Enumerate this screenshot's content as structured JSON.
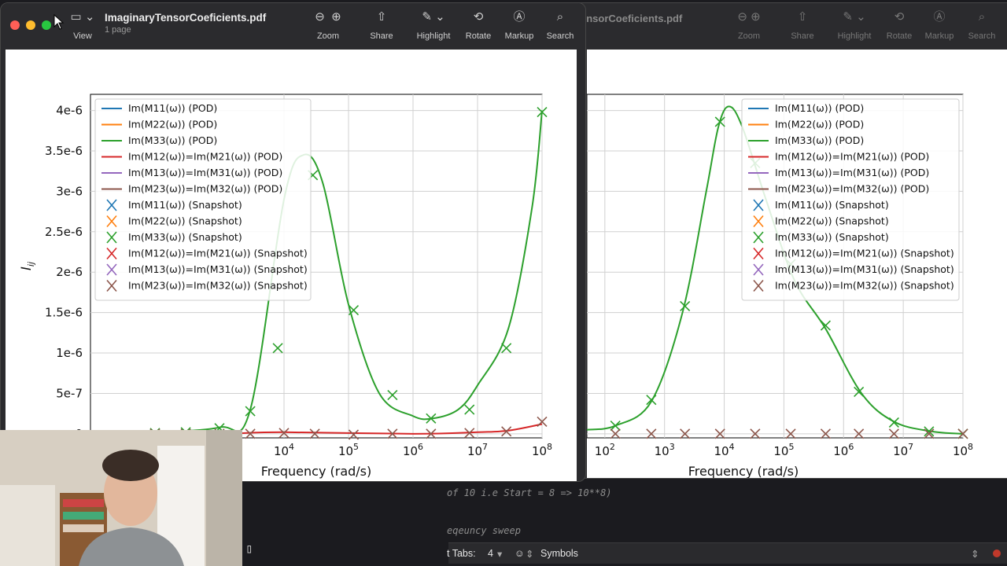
{
  "editor": {
    "code_lines": [
      "of 10 i.e Start = 8 => 10**8)",
      "eqeuncy sweep"
    ],
    "status": {
      "tabs_label": "t Tabs:",
      "tabs_value": "4",
      "symbols_label": "Symbols"
    }
  },
  "window_left": {
    "title": "ImaginaryTensorCoeficients.pdf",
    "subtitle": "1 page",
    "toolbar": [
      {
        "label": "View",
        "icon": "sidebar-icon"
      },
      {
        "label": "Zoom",
        "icon": "zoom-out-icon"
      },
      {
        "label": "Share",
        "icon": "share-icon"
      },
      {
        "label": "Highlight",
        "icon": "highlight-icon"
      },
      {
        "label": "Rotate",
        "icon": "rotate-icon"
      },
      {
        "label": "Markup",
        "icon": "markup-icon"
      },
      {
        "label": "Search",
        "icon": "search-icon"
      }
    ]
  },
  "window_right": {
    "title": "ensorCoeficients.pdf",
    "toolbar": [
      "Zoom",
      "Share",
      "Highlight",
      "Rotate",
      "Markup",
      "Search"
    ]
  },
  "colors": {
    "M11": "#1f77b4",
    "M22": "#ff7f0e",
    "M33": "#2ca02c",
    "M12": "#d62728",
    "M13": "#9467bd",
    "M23": "#8c564b"
  },
  "chart_data": [
    {
      "type": "line",
      "xlabel": "Frequency (rad/s)",
      "ylabel": "I_ij",
      "x_scale": "log",
      "xlim": [
        10,
        100000000
      ],
      "ylim": [
        -5e-08,
        4.2e-06
      ],
      "xticks": [
        "10^4",
        "10^5",
        "10^6",
        "10^7",
        "10^8"
      ],
      "yticks": [
        "0",
        "5e-7",
        "1e-6",
        "1.5e-6",
        "2e-6",
        "2.5e-6",
        "3e-6",
        "3.5e-6",
        "4e-6"
      ],
      "grid": true,
      "legend": "top-left",
      "legend_entries": [
        "Im(M11(ω)) (POD)",
        "Im(M22(ω)) (POD)",
        "Im(M33(ω)) (POD)",
        "Im(M12(ω))=Im(M21(ω)) (POD)",
        "Im(M13(ω))=Im(M31(ω)) (POD)",
        "Im(M23(ω))=Im(M32(ω)) (POD)",
        "Im(M11(ω)) (Snapshot)",
        "Im(M22(ω)) (Snapshot)",
        "Im(M33(ω)) (Snapshot)",
        "Im(M12(ω))=Im(M21(ω)) (Snapshot)",
        "Im(M13(ω))=Im(M31(ω)) (Snapshot)",
        "Im(M23(ω))=Im(M32(ω)) (Snapshot)"
      ],
      "series": [
        {
          "name": "Im(M33(ω)) (POD)",
          "x": [
            100,
            1000,
            3000,
            10000,
            20000,
            40000,
            100000,
            300000,
            1000000,
            2000000,
            5000000,
            10000000,
            30000000,
            70000000,
            100000000
          ],
          "y": [
            2e-08,
            8e-08,
            3e-07,
            2.9e-06,
            3.45e-06,
            3.1e-06,
            1.6e-06,
            5e-07,
            2.2e-07,
            1.9e-07,
            3e-07,
            6e-07,
            1.3e-06,
            2.8e-06,
            4e-06
          ]
        },
        {
          "name": "Im(M12(ω))=Im(M21(ω)) (POD)",
          "x": [
            100,
            1000,
            10000,
            1000000,
            10000000,
            30000000,
            100000000
          ],
          "y": [
            0,
            0,
            2e-08,
            0,
            2e-08,
            4e-08,
            1.2e-07
          ]
        },
        {
          "name": "Im(M33(ω)) (Snapshot)",
          "markers": true,
          "x": [
            100,
            300,
            1000,
            3000,
            8000,
            28000,
            120000,
            480000,
            1900000,
            7500000,
            28000000,
            100000000
          ],
          "y": [
            1e-08,
            2e-08,
            7e-08,
            2.8e-07,
            1.06e-06,
            3.2e-06,
            1.53e-06,
            4.8e-07,
            1.9e-07,
            3e-07,
            1.06e-06,
            3.98e-06
          ]
        },
        {
          "name": "Im(M23(ω))=Im(M32(ω)) (Snapshot)",
          "markers": true,
          "x": [
            100,
            300,
            1000,
            3000,
            10000,
            30000,
            120000,
            480000,
            1900000,
            7500000,
            28000000,
            100000000
          ],
          "y": [
            0,
            0,
            0,
            0,
            1e-08,
            0,
            -1e-08,
            0,
            0,
            1e-08,
            3e-08,
            1.5e-07
          ]
        }
      ]
    },
    {
      "type": "line",
      "xlabel": "Frequency (rad/s)",
      "x_scale": "log",
      "xlim": [
        50,
        100000000
      ],
      "ylim": [
        -5e-08,
        4.2e-06
      ],
      "xticks": [
        "10^2",
        "10^3",
        "10^4",
        "10^5",
        "10^6",
        "10^7",
        "10^8"
      ],
      "grid": true,
      "legend": "top-right",
      "legend_entries": [
        "Im(M11(ω)) (POD)",
        "Im(M22(ω)) (POD)",
        "Im(M33(ω)) (POD)",
        "Im(M12(ω))=Im(M21(ω)) (POD)",
        "Im(M13(ω))=Im(M31(ω)) (POD)",
        "Im(M23(ω))=Im(M32(ω)) (POD)",
        "Im(M11(ω)) (Snapshot)",
        "Im(M22(ω)) (Snapshot)",
        "Im(M33(ω)) (Snapshot)",
        "Im(M12(ω))=Im(M21(ω)) (Snapshot)",
        "Im(M13(ω))=Im(M31(ω)) (Snapshot)",
        "Im(M23(ω))=Im(M32(ω)) (Snapshot)"
      ],
      "series": [
        {
          "name": "Im(M33(ω)) (POD)",
          "x": [
            50,
            150,
            600,
            2000,
            5000,
            8000,
            12000,
            20000,
            50000,
            150000,
            500000,
            2000000,
            7000000,
            30000000,
            100000000
          ],
          "y": [
            5e-08,
            1e-07,
            4e-07,
            1.5e-06,
            3e-06,
            3.8e-06,
            4.05e-06,
            3.8e-06,
            2.9e-06,
            1.9e-06,
            1.3e-06,
            5e-07,
            1.5e-07,
            3e-08,
            0
          ]
        },
        {
          "name": "Im(M33(ω)) (Snapshot)",
          "markers": true,
          "x": [
            150,
            600,
            2200,
            8500,
            33000,
            130000,
            500000,
            1800000,
            7000000,
            27000000,
            100000000
          ],
          "y": [
            1e-07,
            4.2e-07,
            1.58e-06,
            3.86e-06,
            3.35e-06,
            2.1e-06,
            1.34e-06,
            5.2e-07,
            1.4e-07,
            3e-08,
            0
          ]
        },
        {
          "name": "Im(M23(ω))=Im(M32(ω)) (Snapshot)",
          "markers": true,
          "x": [
            150,
            600,
            2200,
            8500,
            33000,
            130000,
            500000,
            1800000,
            7000000,
            27000000,
            100000000
          ],
          "y": [
            0,
            0,
            0,
            0,
            0,
            0,
            0,
            0,
            0,
            0,
            0
          ]
        }
      ]
    }
  ]
}
